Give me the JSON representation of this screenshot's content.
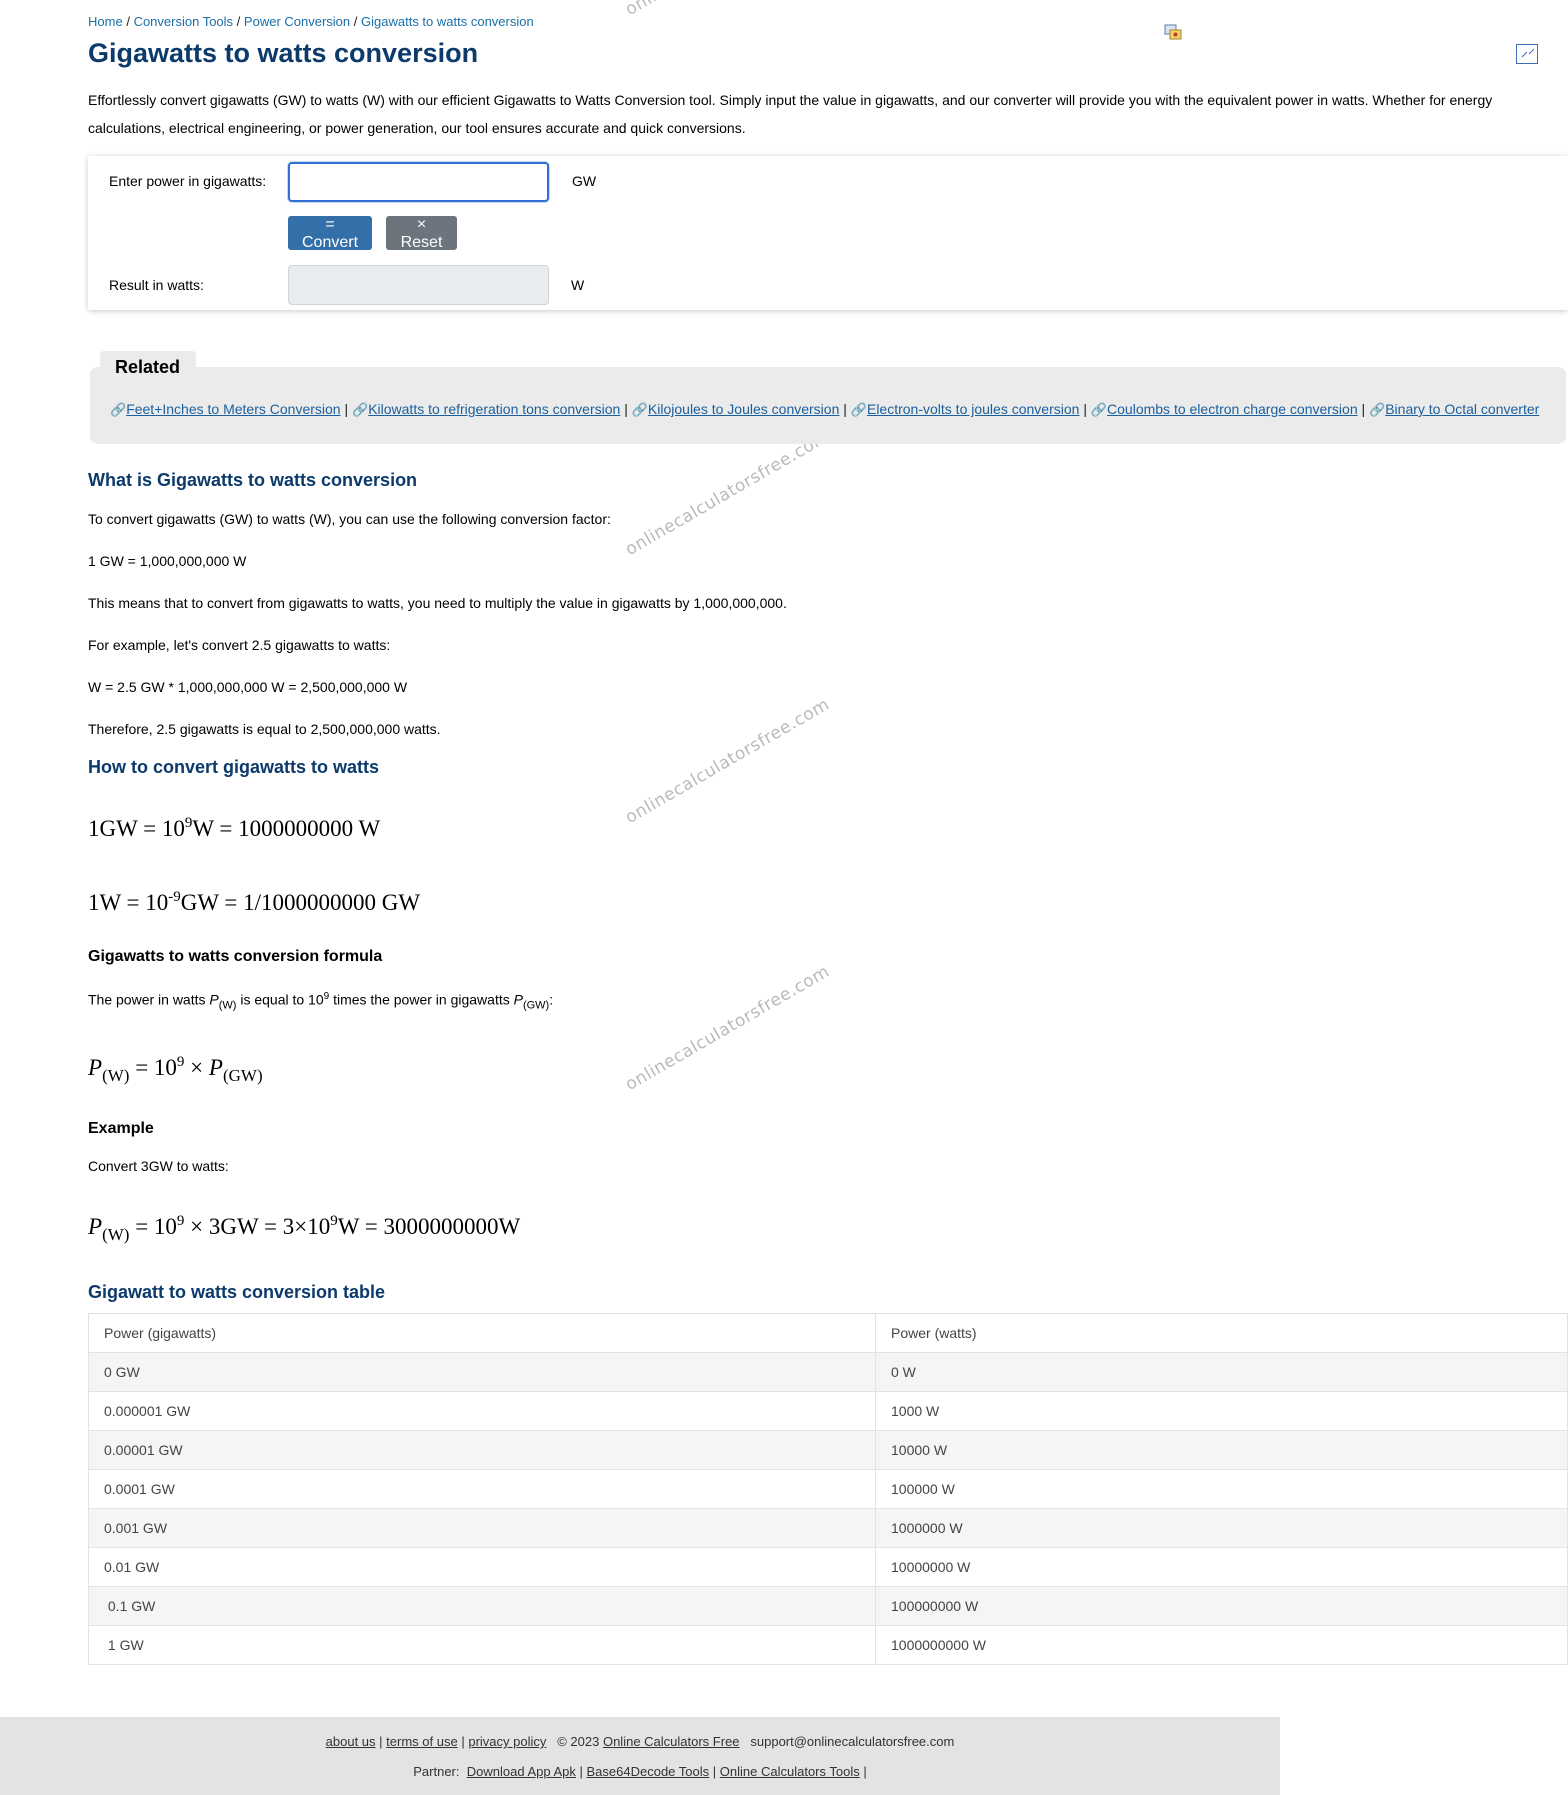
{
  "breadcrumb": {
    "home": "Home",
    "tools": "Conversion Tools",
    "category": "Power Conversion",
    "current": "Gigawatts to watts conversion",
    "separator": "/"
  },
  "watermark_text": "onlinecalculatorsfree.com",
  "page_title": "Gigawatts to watts conversion",
  "intro": "Effortlessly convert gigawatts (GW) to watts (W) with our efficient Gigawatts to Watts Conversion tool. Simply input the value in gigawatts, and our converter will provide you with the equivalent power in watts. Whether for energy calculations, electrical engineering, or power generation, our tool ensures accurate and quick conversions.",
  "calculator": {
    "input_label": "Enter power in gigawatts:",
    "input_value": "",
    "input_unit": "GW",
    "convert_label": "= Convert",
    "reset_label": "× Reset",
    "result_label": "Result in watts:",
    "result_value": "",
    "result_unit": "W"
  },
  "related": {
    "title": "Related",
    "link_icon": "link-icon",
    "separator": "|",
    "links": [
      "Feet+Inches to Meters Conversion",
      "Kilowatts to refrigeration tons conversion",
      "Kilojoules to Joules conversion",
      "Electron-volts to joules conversion",
      "Coulombs to electron charge conversion",
      "Binary to Octal converter"
    ]
  },
  "what_is": {
    "heading": "What is Gigawatts to watts conversion",
    "p1": "To convert gigawatts (GW) to watts (W), you can use the following conversion factor:",
    "p2": "1 GW = 1,000,000,000 W",
    "p3": "This means that to convert from gigawatts to watts, you need to multiply the value in gigawatts by 1,000,000,000.",
    "p4": "For example, let's convert 2.5 gigawatts to watts:",
    "p5": "W = 2.5 GW * 1,000,000,000 W = 2,500,000,000 W",
    "p6": "Therefore, 2.5 gigawatts is equal to 2,500,000,000 watts."
  },
  "how_to": {
    "heading": "How to convert gigawatts to watts",
    "eq1": {
      "a": "1GW = 10",
      "exp": "9",
      "b": "W = 1000000000 W"
    },
    "eq2": {
      "a": "1W = 10",
      "exp": "-9",
      "b": "GW = 1/1000000000 GW"
    }
  },
  "formula": {
    "heading": "Gigawatts to watts conversion formula",
    "text_a": "The power in watts ",
    "p": "P",
    "sub_w": "(W)",
    "text_b": " is equal to 10",
    "exp": "9",
    "text_c": " times the power in gigawatts ",
    "sub_gw": "(GW)",
    "text_d": ":",
    "eq": {
      "p": "P",
      "sub_w": "(W)",
      "mid": " = 10",
      "exp": "9",
      "times": " × ",
      "p2": "P",
      "sub_gw": "(GW)"
    }
  },
  "example": {
    "heading": "Example",
    "text": "Convert 3GW to watts:",
    "eq": {
      "p": "P",
      "sub_w": "(W)",
      "a": " = 10",
      "exp1": "9",
      "b": " × 3GW = 3×10",
      "exp2": "9",
      "c": "W = 3000000000W"
    }
  },
  "table": {
    "heading": "Gigawatt to watts conversion table",
    "headers": [
      "Power (gigawatts)",
      "Power (watts)"
    ],
    "rows": [
      [
        "0 GW",
        "0 W"
      ],
      [
        "0.000001 GW",
        "1000 W"
      ],
      [
        "0.00001 GW",
        "10000 W"
      ],
      [
        "0.0001 GW",
        "100000 W"
      ],
      [
        "0.001 GW",
        "1000000 W"
      ],
      [
        "0.01 GW",
        "10000000 W"
      ],
      [
        " 0.1 GW",
        "100000000 W"
      ],
      [
        " 1 GW",
        "1000000000 W"
      ]
    ]
  },
  "footer": {
    "about": "about us",
    "terms": "terms of use",
    "privacy": "privacy policy",
    "copyright": "© 2023",
    "site": "Online Calculators Free",
    "email": "support@onlinecalculatorsfree.com",
    "partner_label": "Partner:",
    "partners": [
      "Download App Apk",
      "Base64Decode Tools",
      "Online Calculators Tools"
    ],
    "separator": "|"
  }
}
